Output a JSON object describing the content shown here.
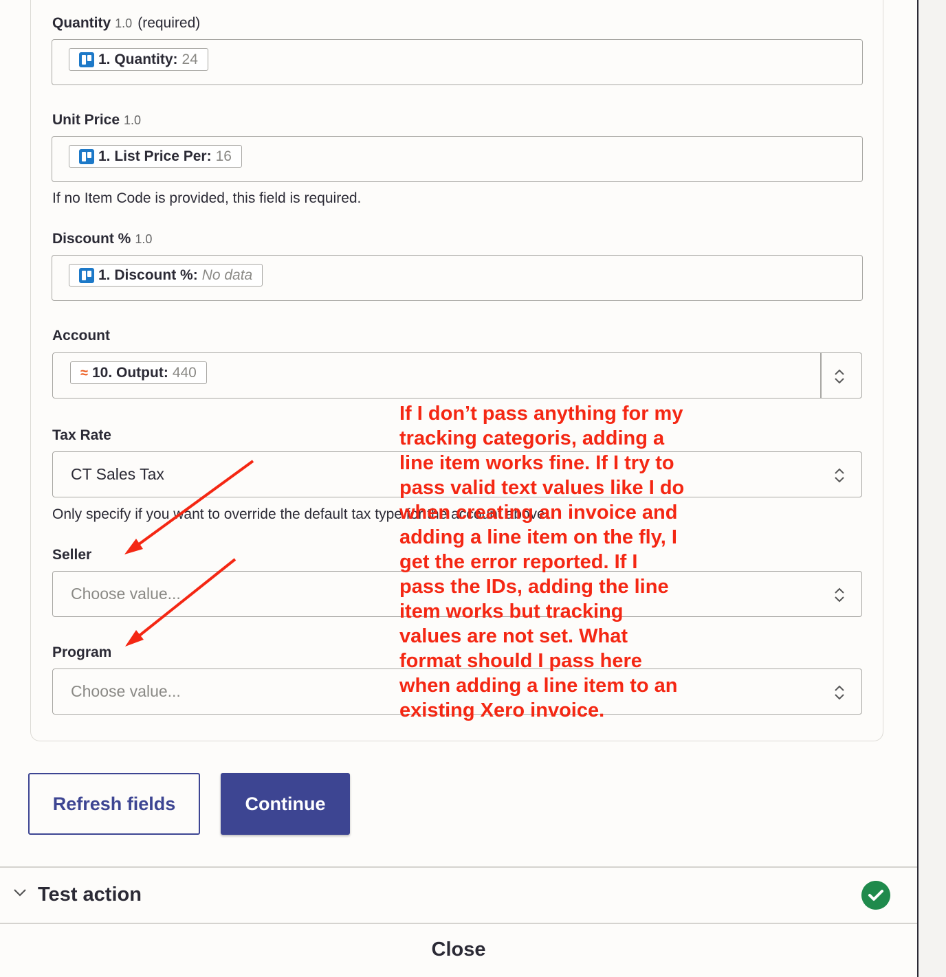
{
  "fields": {
    "quantity": {
      "label": "Quantity",
      "version": "1.0",
      "required": "(required)",
      "pill_name": "1. Quantity:",
      "pill_value": "24"
    },
    "unit_price": {
      "label": "Unit Price",
      "version": "1.0",
      "pill_name": "1. List Price Per:",
      "pill_value": "16",
      "help": "If no Item Code is provided, this field is required."
    },
    "discount": {
      "label": "Discount %",
      "version": "1.0",
      "pill_name": "1. Discount %:",
      "pill_value": "No data"
    },
    "account": {
      "label": "Account",
      "pill_name": "10. Output:",
      "pill_value": "440"
    },
    "tax_rate": {
      "label": "Tax Rate",
      "value": "CT Sales Tax",
      "help": "Only specify if you want to override the default tax type for the account above."
    },
    "seller": {
      "label": "Seller",
      "placeholder": "Choose value..."
    },
    "program": {
      "label": "Program",
      "placeholder": "Choose value..."
    }
  },
  "annotation": {
    "text": "If I don’t pass anything for my tracking categoris, adding a line item works fine. If I try to pass valid text values like I do when creating an invoice and adding a line item on the fly, I get the error reported. If I pass the IDs, adding the line item works but tracking values are not set. What format should I pass here when adding a line item to an existing Xero invoice.",
    "color": "#f42713"
  },
  "buttons": {
    "refresh": "Refresh fields",
    "continue": "Continue"
  },
  "test_section": {
    "label": "Test action",
    "status": "success"
  },
  "footer": {
    "close": "Close"
  },
  "colors": {
    "accent": "#3d4592",
    "success": "#1f8a4c",
    "trello": "#1d79c8",
    "formatter": "#ec5a1c"
  }
}
